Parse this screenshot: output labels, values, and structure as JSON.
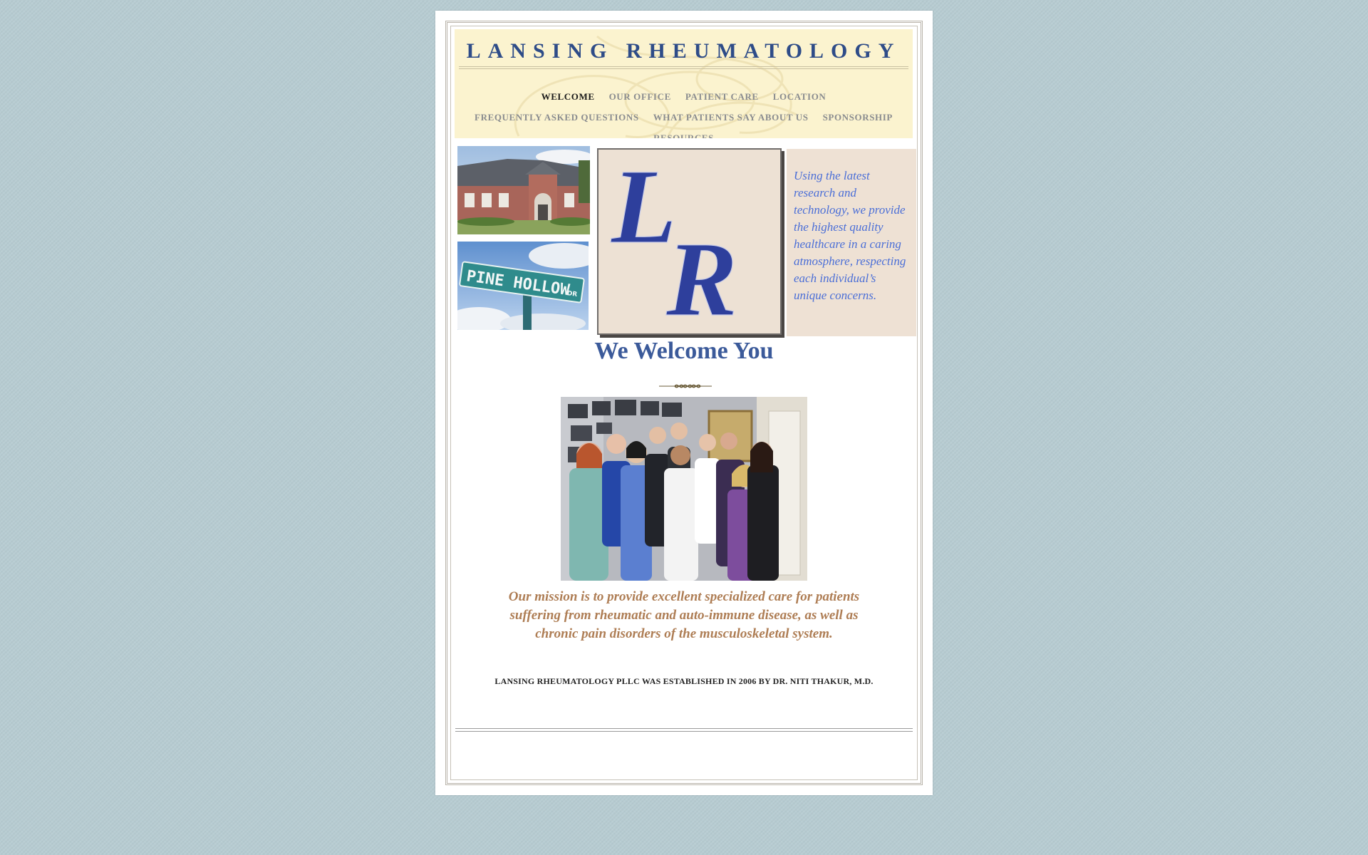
{
  "header": {
    "site_title": "LANSING RHEUMATOLOGY"
  },
  "nav": {
    "row1": [
      {
        "label": "WELCOME",
        "active": true
      },
      {
        "label": "OUR OFFICE",
        "active": false
      },
      {
        "label": "PATIENT CARE",
        "active": false
      },
      {
        "label": "LOCATION",
        "active": false
      }
    ],
    "row2": [
      {
        "label": "FREQUENTLY ASKED QUESTIONS",
        "active": false
      },
      {
        "label": "WHAT PATIENTS SAY ABOUT US",
        "active": false
      },
      {
        "label": "SPONSORSHIP",
        "active": false
      }
    ],
    "row3": [
      {
        "label": "RESOURCES",
        "active": false
      }
    ]
  },
  "logo": {
    "letters": [
      "L",
      "R"
    ]
  },
  "sign": {
    "text": "PINE HOLLOW",
    "suffix": "DR"
  },
  "tagline": "Using the latest research and technology, we provide the highest quality healthcare in a caring atmosphere, respecting each individual’s unique concerns.",
  "welcome_heading": "We Welcome You",
  "mission": "Our mission is to provide excellent specialized care for patients suffering from rheumatic and auto-immune disease, as well as chronic pain disorders of the musculoskeletal system.",
  "established": "LANSING RHEUMATOLOGY PLLC WAS ESTABLISHED IN 2006 BY DR. NITI THAKUR, M.D.",
  "colors": {
    "background": "#b7ccd2",
    "header_bg": "#fbf3cf",
    "title_blue": "#2e4c88",
    "tagline_blue": "#4a6ed7",
    "mission_brown": "#ae7d54",
    "box_beige": "#ede1d4"
  }
}
